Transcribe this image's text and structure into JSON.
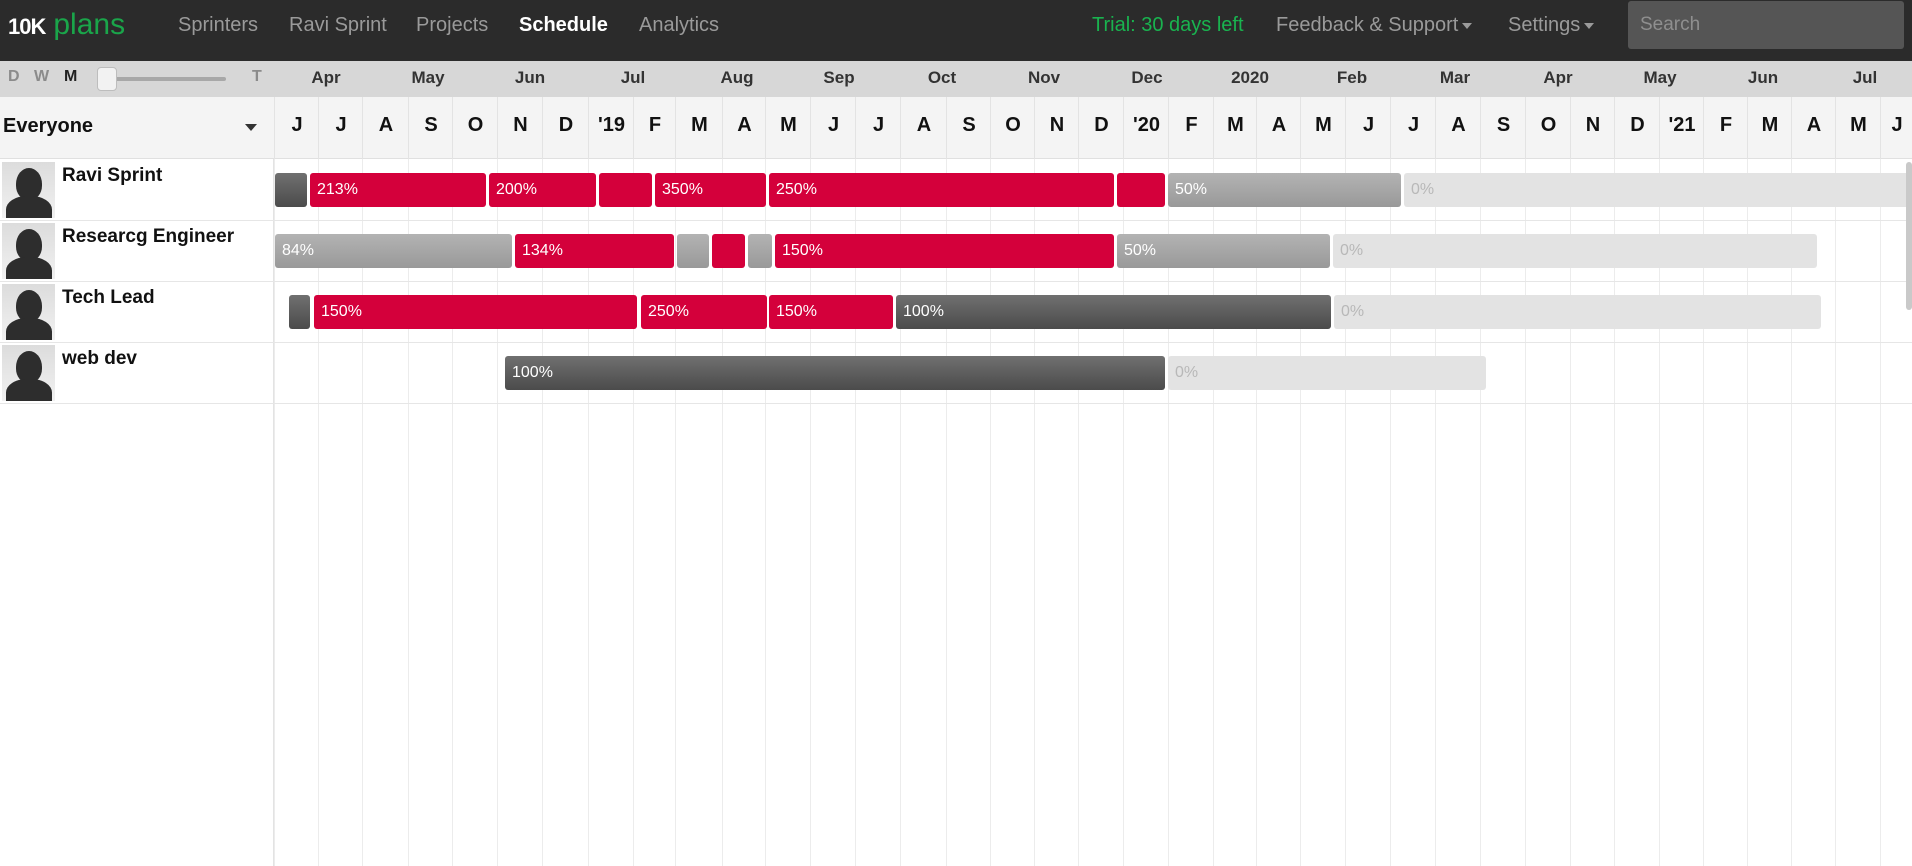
{
  "nav": {
    "logo_mark": "10K",
    "logo_text": "plans",
    "links": [
      "Sprinters",
      "Ravi Sprint",
      "Projects",
      "Schedule",
      "Analytics"
    ],
    "active_link": "Schedule",
    "trial": "Trial: 30 days left",
    "feedback": "Feedback & Support",
    "settings": "Settings",
    "search_placeholder": "Search"
  },
  "zoom": {
    "labels": [
      "D",
      "W",
      "M",
      "T"
    ],
    "selected": "M"
  },
  "filter": {
    "label": "Everyone"
  },
  "months": [
    "Apr",
    "May",
    "Jun",
    "Jul",
    "Aug",
    "Sep",
    "Oct",
    "Nov",
    "Dec",
    "2020",
    "Feb",
    "Mar",
    "Apr",
    "May",
    "Jun",
    "Jul"
  ],
  "letters": [
    "J",
    "J",
    "A",
    "S",
    "O",
    "N",
    "D",
    "'19",
    "F",
    "M",
    "A",
    "M",
    "J",
    "J",
    "A",
    "S",
    "O",
    "N",
    "D",
    "'20",
    "F",
    "M",
    "A",
    "M",
    "J",
    "J",
    "A",
    "S",
    "O",
    "N",
    "D",
    "'21",
    "F",
    "M",
    "A",
    "M",
    "J"
  ],
  "people": [
    {
      "name": "Ravi Sprint",
      "bars": [
        {
          "label": "",
          "style": "dark"
        },
        {
          "label": "213%",
          "style": "red"
        },
        {
          "label": "200%",
          "style": "red"
        },
        {
          "label": "",
          "style": "red"
        },
        {
          "label": "350%",
          "style": "red"
        },
        {
          "label": "250%",
          "style": "red"
        },
        {
          "label": "",
          "style": "red"
        },
        {
          "label": "50%",
          "style": "grey"
        },
        {
          "label": "0%",
          "style": "light"
        }
      ]
    },
    {
      "name": "Researcg Engineer",
      "bars": [
        {
          "label": "84%",
          "style": "grey"
        },
        {
          "label": "134%",
          "style": "red"
        },
        {
          "label": "",
          "style": "grey"
        },
        {
          "label": "",
          "style": "red"
        },
        {
          "label": "",
          "style": "grey"
        },
        {
          "label": "150%",
          "style": "red"
        },
        {
          "label": "50%",
          "style": "grey"
        },
        {
          "label": "0%",
          "style": "light"
        }
      ]
    },
    {
      "name": "Tech Lead",
      "bars": [
        {
          "label": "",
          "style": "dark"
        },
        {
          "label": "150%",
          "style": "red"
        },
        {
          "label": "250%",
          "style": "red"
        },
        {
          "label": "150%",
          "style": "red"
        },
        {
          "label": "100%",
          "style": "dark"
        },
        {
          "label": "0%",
          "style": "light"
        }
      ]
    },
    {
      "name": "web dev",
      "bars": [
        {
          "label": "100%",
          "style": "dark"
        },
        {
          "label": "0%",
          "style": "light"
        }
      ]
    }
  ]
}
